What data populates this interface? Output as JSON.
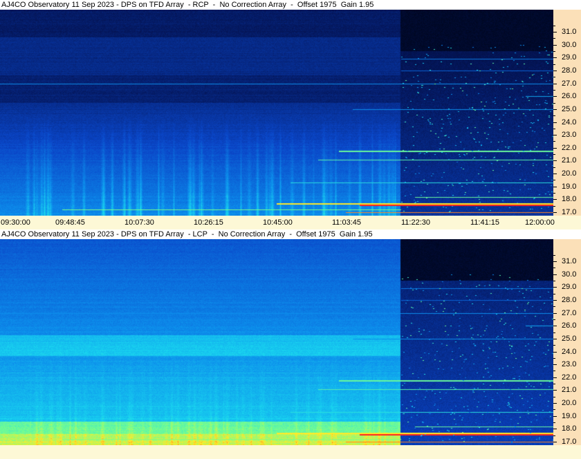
{
  "chart_data": [
    {
      "type": "heatmap",
      "title": "AJ4CO Observatory 11 Sep 2023 - DPS on TFD Array  - RCP  -  No Correction Array  -  Offset 1975  Gain 1.95",
      "polarization": "RCP",
      "x_tick_labels": [
        "09:30:00",
        "09:48:45",
        "10:07:30",
        "10:26:15",
        "10:45:00",
        "11:03:45",
        "11:22:30",
        "11:41:15",
        "12:00:00"
      ],
      "y_tick_labels": [
        "31.0",
        "30.0",
        "29.0",
        "28.0",
        "27.0",
        "26.0",
        "25.0",
        "24.0",
        "23.0",
        "22.0",
        "21.0",
        "20.0",
        "19.0",
        "18.0",
        "17.0"
      ],
      "y_range": [
        16.5,
        32.0
      ],
      "x_range": [
        "09:30:00",
        "12:00:00"
      ],
      "colors": {
        "low": "#000820",
        "mid": "#0a5ad8",
        "high": "#19e0f0",
        "peak": "#ff2020"
      }
    },
    {
      "type": "heatmap",
      "title": "AJ4CO Observatory 11 Sep 2023 - DPS on TFD Array  - LCP  -  No Correction Array  -  Offset 1975  Gain 1.95",
      "polarization": "LCP",
      "x_tick_labels": [],
      "y_tick_labels": [
        "31.0",
        "30.0",
        "29.0",
        "28.0",
        "27.0",
        "26.0",
        "25.0",
        "24.0",
        "23.0",
        "22.0",
        "21.0",
        "20.0",
        "19.0",
        "18.0",
        "17.0"
      ],
      "y_range": [
        16.5,
        32.0
      ],
      "x_range": [
        "09:30:00",
        "12:00:00"
      ],
      "colors": {
        "low": "#000820",
        "mid": "#0a5ad8",
        "high": "#19e0f0",
        "peak": "#ff2020"
      }
    }
  ]
}
